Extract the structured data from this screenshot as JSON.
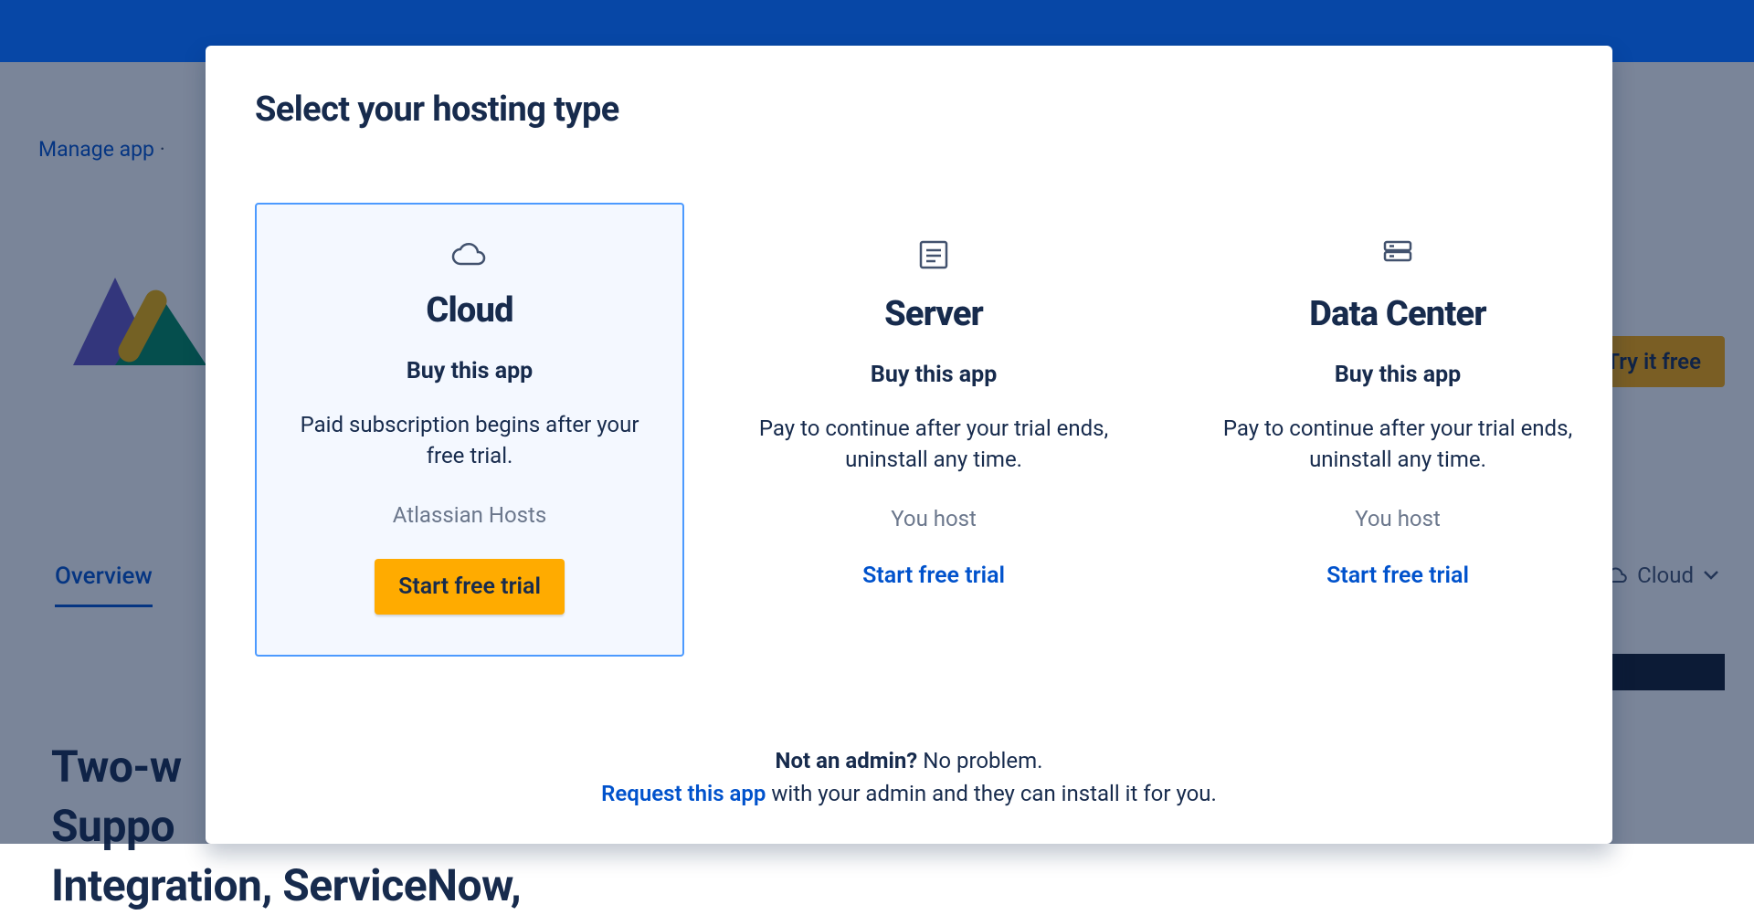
{
  "breadcrumb": {
    "manage": "Manage app",
    "sep": " · "
  },
  "try_button": "Try it free",
  "tab_overview": "Overview",
  "cloud_chip": "Cloud",
  "headline_line1": "Two-w",
  "headline_line2": "Suppo",
  "headline_line3": "Integration, ServiceNow,",
  "modal": {
    "title": "Select your hosting type",
    "options": {
      "cloud": {
        "name": "Cloud",
        "subhead": "Buy this app",
        "desc": "Paid subscription begins after your free trial.",
        "host": "Atlassian Hosts",
        "cta": "Start free trial"
      },
      "server": {
        "name": "Server",
        "subhead": "Buy this app",
        "desc": "Pay to continue after your trial ends, uninstall any time.",
        "host": "You host",
        "cta": "Start free trial"
      },
      "datacenter": {
        "name": "Data Center",
        "subhead": "Buy this app",
        "desc": "Pay to continue after your trial ends, uninstall any time.",
        "host": "You host",
        "cta": "Start free trial"
      }
    },
    "not_admin_strong": "Not an admin?",
    "not_admin_rest": " No problem.",
    "request_link": "Request this app",
    "request_rest": " with your admin and they can install it for you."
  }
}
